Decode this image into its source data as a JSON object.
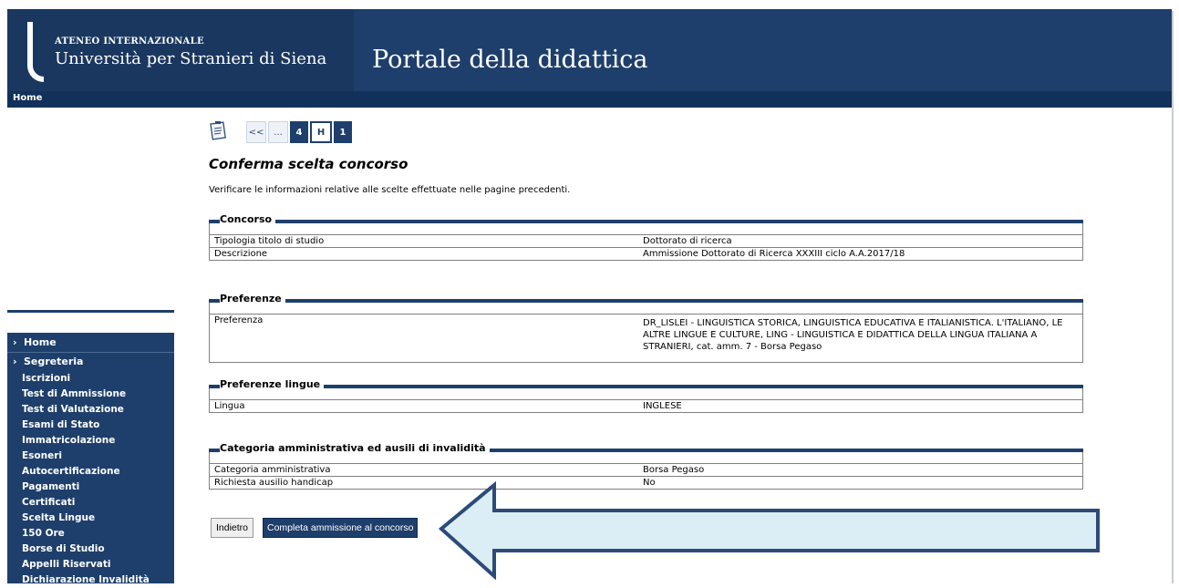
{
  "header": {
    "ateneo": "ATENEO INTERNAZIONALE",
    "university": "Università per Stranieri di Siena",
    "portal_title": "Portale della didattica"
  },
  "navbar": {
    "home": "Home"
  },
  "sidebar": {
    "home": "Home",
    "segreteria": "Segreteria",
    "items": [
      "Iscrizioni",
      "Test di Ammissione",
      "Test di Valutazione",
      "Esami di Stato",
      "Immatricolazione",
      "Esoneri",
      "Autocertificazione",
      "Pagamenti",
      "Certificati",
      "Scelta Lingue",
      "150 Ore",
      "Borse di Studio",
      "Appelli Riservati",
      "Dichiarazione Invalidità"
    ]
  },
  "wizard": {
    "first": "<<",
    "ellipsis": "...",
    "step4": "4",
    "stepH": "H",
    "step1": "1"
  },
  "page": {
    "title": "Conferma scelta concorso",
    "intro": "Verificare le informazioni relative alle scelte effettuate nelle pagine precedenti."
  },
  "sections": {
    "concorso": {
      "legend": "Concorso",
      "rows": [
        {
          "label": "Tipologia titolo di studio",
          "value": "Dottorato di ricerca"
        },
        {
          "label": "Descrizione",
          "value": "Ammissione Dottorato di Ricerca XXXIII ciclo A.A.2017/18"
        }
      ]
    },
    "preferenze": {
      "legend": "Preferenze",
      "rows": [
        {
          "label": "Preferenza",
          "value": "DR_LISLEI - LINGUISTICA STORICA, LINGUISTICA EDUCATIVA E ITALIANISTICA. L'ITALIANO, LE ALTRE LINGUE E CULTURE, LING - LINGUISTICA E DIDATTICA DELLA LINGUA ITALIANA A STRANIERI, cat. amm. 7 - Borsa Pegaso"
        }
      ]
    },
    "lingue": {
      "legend": "Preferenze lingue",
      "rows": [
        {
          "label": "Lingua",
          "value": "INGLESE"
        }
      ]
    },
    "categoria": {
      "legend": "Categoria amministrativa ed ausili di invalidità",
      "rows": [
        {
          "label": "Categoria amministrativa",
          "value": "Borsa Pegaso"
        },
        {
          "label": "Richiesta ausilio handicap",
          "value": "No"
        }
      ]
    }
  },
  "buttons": {
    "back": "Indietro",
    "submit": "Completa ammissione al concorso"
  },
  "colors": {
    "brand": "#1e3f6b",
    "arrow_fill": "#dbeef5"
  }
}
